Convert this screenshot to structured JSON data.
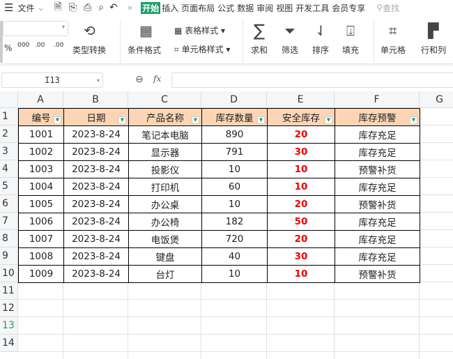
{
  "menu": {
    "file": "文件",
    "tabs": [
      "开始",
      "插入",
      "页面布局",
      "公式",
      "数据",
      "审阅",
      "视图",
      "开发工具",
      "会员专享"
    ],
    "search": "查找"
  },
  "ribbon": {
    "type_convert": "类型转换",
    "cond_format": "条件格式",
    "table_style": "表格样式",
    "cell_style": "单元格样式",
    "sum": "求和",
    "filter": "筛选",
    "sort": "排序",
    "fill": "填充",
    "cell": "单元格",
    "row_col": "行和列",
    "num_formats": [
      "%",
      "000",
      ".00",
      ".00"
    ]
  },
  "formula_bar": {
    "name_box": "I13",
    "fx": "fx",
    "value": ""
  },
  "columns": [
    "A",
    "B",
    "C",
    "D",
    "E",
    "F",
    "G"
  ],
  "rows": [
    "1",
    "2",
    "3",
    "4",
    "5",
    "6",
    "7",
    "8",
    "9",
    "10",
    "11",
    "12",
    "13",
    "14"
  ],
  "headers": [
    "编号",
    "日期",
    "产品名称",
    "库存数量",
    "安全库存",
    "库存预警"
  ],
  "data": [
    [
      "1001",
      "2023-8-24",
      "笔记本电脑",
      "890",
      "20",
      "库存充足"
    ],
    [
      "1002",
      "2023-8-24",
      "显示器",
      "791",
      "30",
      "库存充足"
    ],
    [
      "1003",
      "2023-8-24",
      "投影仪",
      "10",
      "10",
      "预警补货"
    ],
    [
      "1004",
      "2023-8-24",
      "打印机",
      "60",
      "10",
      "库存充足"
    ],
    [
      "1005",
      "2023-8-24",
      "办公桌",
      "10",
      "20",
      "预警补货"
    ],
    [
      "1006",
      "2023-8-24",
      "办公椅",
      "182",
      "50",
      "库存充足"
    ],
    [
      "1007",
      "2023-8-24",
      "电饭煲",
      "720",
      "20",
      "库存充足"
    ],
    [
      "1008",
      "2023-8-24",
      "键盘",
      "40",
      "30",
      "库存充足"
    ],
    [
      "1009",
      "2023-8-24",
      "台灯",
      "10",
      "10",
      "预警补货"
    ]
  ],
  "colors": {
    "header_fill": "#fbd5b5",
    "accent": "#1e9e6e",
    "warn": "#e00000"
  }
}
